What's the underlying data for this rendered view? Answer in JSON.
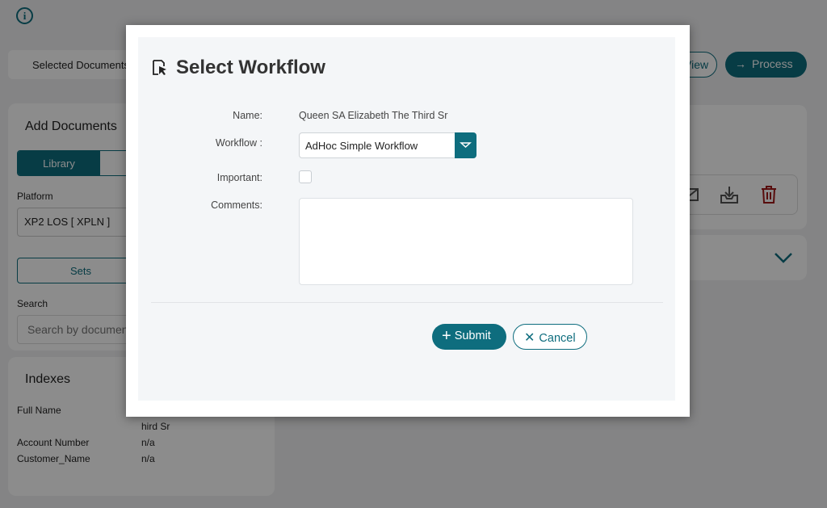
{
  "background": {
    "info_icon": "i",
    "selected_documents_label": "Selected Documents",
    "view_button": "View",
    "process_button": "Process",
    "add_documents": {
      "title": "Add Documents",
      "tab_library": "Library",
      "platform_label": "Platform",
      "platform_value": "XP2 LOS [ XPLN ]",
      "sets_button": "Sets",
      "search_label": "Search",
      "search_placeholder": "Search by document"
    },
    "indexes": {
      "title": "Indexes",
      "rows": [
        {
          "label": "Full Name",
          "value": "hird Sr"
        },
        {
          "label": "Account Number",
          "value": "n/a"
        },
        {
          "label": "Customer_Name",
          "value": "n/a"
        }
      ]
    },
    "colors": {
      "accent": "#0e6d7e",
      "delete": "#a01818"
    }
  },
  "modal": {
    "title": "Select Workflow",
    "title_icon": "cursor-select-icon",
    "name_label": "Name:",
    "name_value": "Queen SA Elizabeth The Third Sr",
    "workflow_label": "Workflow :",
    "workflow_value": "AdHoc Simple Workflow",
    "important_label": "Important:",
    "comments_label": "Comments:",
    "submit_label": "Submit",
    "cancel_label": "Cancel"
  }
}
